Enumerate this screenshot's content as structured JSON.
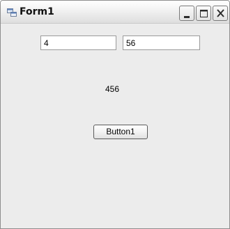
{
  "window": {
    "title": "Form1",
    "icon": "form-window-icon",
    "controls": [
      "minimize-icon",
      "maximize-icon",
      "close-icon"
    ]
  },
  "form": {
    "textbox1_value": "4",
    "textbox2_value": "56",
    "result_label": "456",
    "button_label": "Button1"
  }
}
